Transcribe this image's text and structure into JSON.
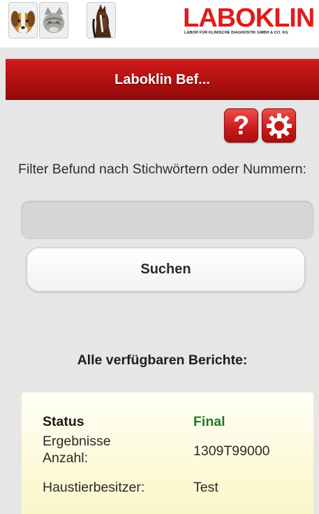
{
  "brand": {
    "animals": [
      "dog-icon",
      "cat-icon",
      "horse-icon"
    ],
    "logo_text": "LABOKLIN",
    "logo_tagline": "LABOR FÜR KLINISCHE DIAGNOSTIK GMBH & CO. KG",
    "logo_color": "#e21b1b"
  },
  "header": {
    "title": "Laboklin Bef...",
    "color": "#b01010"
  },
  "toolbar": {
    "help_icon": "help-icon",
    "help_glyph": "?",
    "settings_icon": "gear-icon"
  },
  "filter": {
    "label": "Filter Befund nach Stichwörtern oder Nummern:",
    "value": "",
    "placeholder": ""
  },
  "search": {
    "button_label": "Suchen"
  },
  "reports": {
    "heading": "Alle verfügbaren Berichte:",
    "items": [
      {
        "status_label": "Status",
        "status_value": "Final",
        "count_label": "Ergebnisse Anzahl:",
        "count_value": "1309T99000",
        "owner_label": "Haustierbesitzer:",
        "owner_value": "Test"
      }
    ]
  },
  "colors": {
    "status_final": "#1b7d24",
    "card_background": "#fbf6c8"
  }
}
